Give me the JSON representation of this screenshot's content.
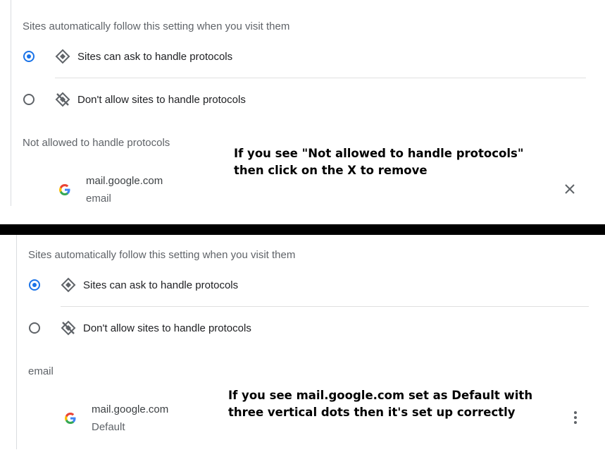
{
  "top": {
    "heading": "Sites automatically follow this setting when you visit them",
    "options": [
      {
        "label": "Sites can ask to handle protocols",
        "checked": true,
        "icon": "protocol-handler-icon"
      },
      {
        "label": "Don't allow sites to handle protocols",
        "checked": false,
        "icon": "protocol-handler-off-icon"
      }
    ],
    "section_label": "Not allowed to handle protocols",
    "site": {
      "name": "mail.google.com",
      "sub": "email",
      "action_icon": "close-icon"
    },
    "annotation": [
      "If you see \"Not allowed to handle protocols\"",
      "then click on the X to remove"
    ]
  },
  "bottom": {
    "heading": "Sites automatically follow this setting when you visit them",
    "options": [
      {
        "label": "Sites can ask to handle protocols",
        "checked": true,
        "icon": "protocol-handler-icon"
      },
      {
        "label": "Don't allow sites to handle protocols",
        "checked": false,
        "icon": "protocol-handler-off-icon"
      }
    ],
    "section_label": "email",
    "site": {
      "name": "mail.google.com",
      "sub": "Default",
      "action_icon": "more-vert-icon"
    },
    "annotation": [
      "If you see mail.google.com set as Default with",
      "three vertical dots then it's set up correctly"
    ]
  },
  "colors": {
    "accent": "#1a73e8",
    "text": "#202124",
    "secondary": "#5f6368",
    "separator": "#000000"
  }
}
